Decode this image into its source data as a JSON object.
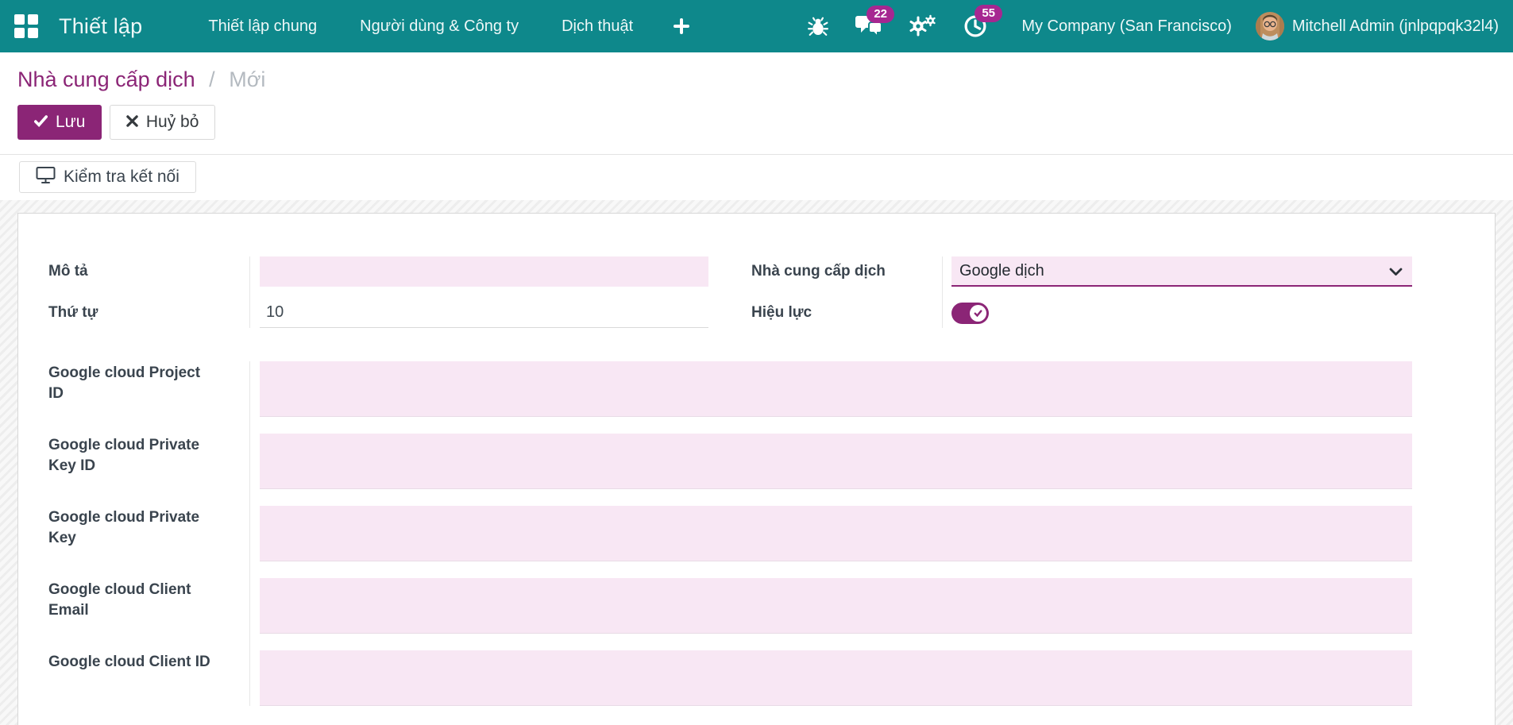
{
  "colors": {
    "topbar": "#0e888b",
    "primary": "#8b2576",
    "badge": "#a62791",
    "field-pink": "#f8e7f4",
    "label": "#3a444e"
  },
  "topbar": {
    "app_title": "Thiết lập",
    "menus": [
      "Thiết lập chung",
      "Người dùng & Công ty",
      "Dịch thuật"
    ],
    "messages_badge": "22",
    "activities_badge": "55",
    "company": "My Company (San Francisco)",
    "user": "Mitchell Admin (jnlpqpqk32l4)"
  },
  "breadcrumb": {
    "parent": "Nhà cung cấp dịch",
    "separator": "/",
    "current": "Mới"
  },
  "buttons": {
    "save": "Lưu",
    "cancel": "Huỷ bỏ",
    "test_connection": "Kiểm tra kết nối"
  },
  "form": {
    "description": {
      "label": "Mô tả",
      "value": ""
    },
    "sequence": {
      "label": "Thứ tự",
      "value": "10"
    },
    "provider": {
      "label": "Nhà cung cấp dịch",
      "value": "Google dịch"
    },
    "active": {
      "label": "Hiệu lực",
      "checked": true
    },
    "google": [
      {
        "label": "Google cloud Project ID",
        "value": ""
      },
      {
        "label": "Google cloud Private Key ID",
        "value": ""
      },
      {
        "label": "Google cloud Private Key",
        "value": ""
      },
      {
        "label": "Google cloud Client Email",
        "value": ""
      },
      {
        "label": "Google cloud Client ID",
        "value": ""
      }
    ]
  }
}
